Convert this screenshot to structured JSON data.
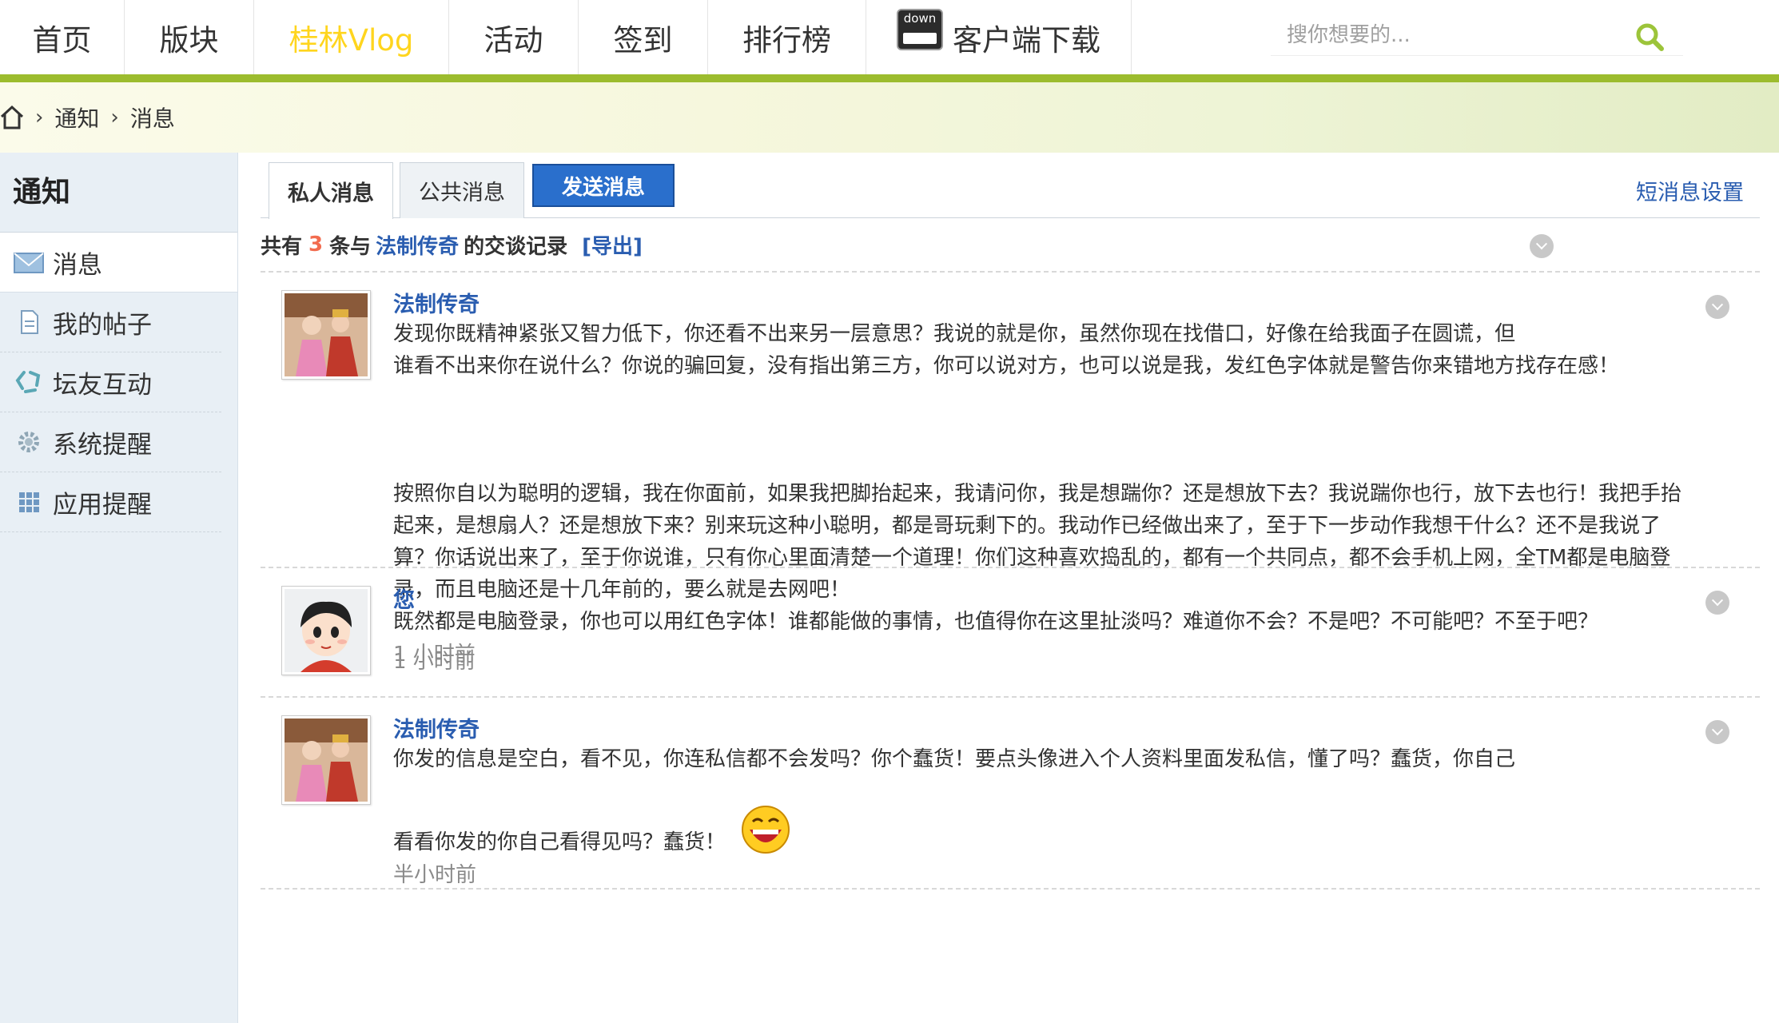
{
  "nav": {
    "items": [
      "首页",
      "版块",
      "桂林Vlog",
      "活动",
      "签到",
      "排行榜"
    ],
    "download_label": "客户端下载",
    "download_icon_text": "down",
    "search_placeholder": "搜你想要的..."
  },
  "breadcrumb": {
    "items": [
      "通知",
      "消息"
    ]
  },
  "sidebar": {
    "title": "通知",
    "items": [
      "消息",
      "我的帖子",
      "坛友互动",
      "系统提醒",
      "应用提醒"
    ]
  },
  "tabs": {
    "private": "私人消息",
    "public": "公共消息",
    "send": "发送消息",
    "settings": "短消息设置"
  },
  "summary": {
    "prefix": "共有",
    "count": "3",
    "middle": "条与",
    "user": "法制传奇",
    "suffix": "的交谈记录",
    "export": "[导出]"
  },
  "messages": [
    {
      "author": "法制传奇",
      "para1_line1": "发现你既精神紧张又智力低下，你还看不出来另一层意思？我说的就是你，虽然你现在找借口，好像在给我面子在圆谎，但",
      "para1_line2": "谁看不出来你在说什么？你说的骗回复，没有指出第三方，你可以说对方，也可以说是我，发红色字体就是警告你来错地方找存在感！",
      "para2_line1": "按照你自以为聪明的逻辑，我在你面前，如果我把脚抬起来，我请问你，我是想踹你？还是想放下去？我说踹你也行，放下去也行！我把手抬",
      "para2_line2": "起来，是想扇人？还是想放下来？别来玩这种小聪明，都是哥玩剩下的。我动作已经做出来了，至于下一步动作我想干什么？还不是我说了",
      "para2_line3": "算？你话说出来了，至于你说谁，只有你心里面清楚一个道理！你们这种喜欢捣乱的，都有一个共同点，都不会手机上网，全TM都是电脑登",
      "para2_line4": "录，而且电脑还是十几年前的，要么就是去网吧！",
      "para2_line5": "既然都是电脑登录，你也可以用红色字体！谁都能做的事情，也值得你在这里扯淡吗？难道你不会？不是吧？不可能吧？不至于吧？",
      "time": "1 小时前"
    },
    {
      "author": "您",
      "time": "1 小时前"
    },
    {
      "author": "法制传奇",
      "line1": "你发的信息是空白，看不见，你连私信都不会发吗？你个蠢货！要点头像进入个人资料里面发私信，懂了吗？蠢货，你自己",
      "line2": "看看你发的你自己看得见吗？蠢货！",
      "time": "半小时前"
    }
  ],
  "colors": {
    "accent_green": "#9cbc2e",
    "link_blue": "#2a5db0",
    "button_blue": "#2a6fcc",
    "active_nav": "#ffd51e",
    "count_red": "#f26c4f"
  }
}
